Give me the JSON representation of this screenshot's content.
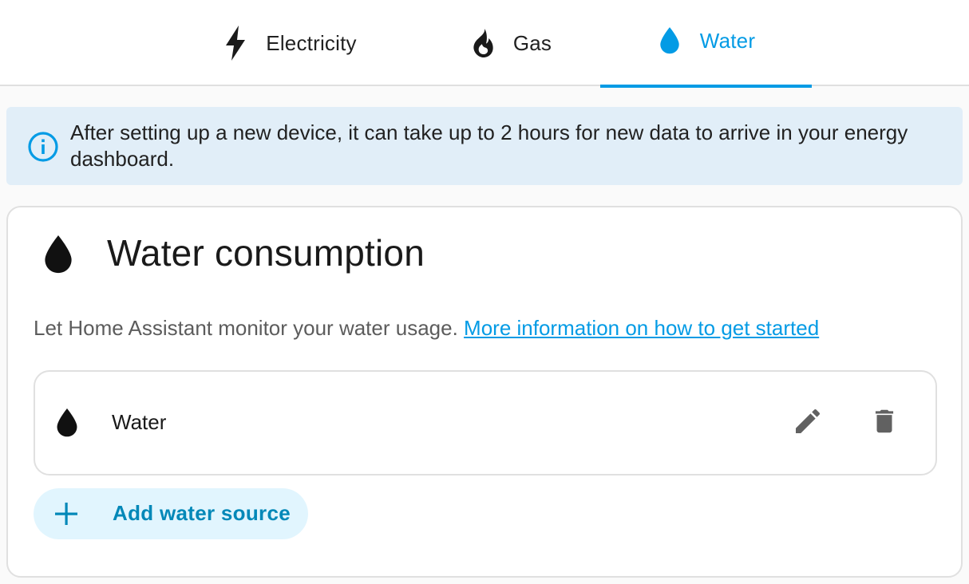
{
  "tabs": [
    {
      "label": "Electricity",
      "icon": "lightning-bolt-icon"
    },
    {
      "label": "Gas",
      "icon": "fire-icon"
    },
    {
      "label": "Water",
      "icon": "water-drop-icon",
      "active": true
    }
  ],
  "alert": {
    "icon": "info-icon",
    "text": "After setting up a new device, it can take up to 2 hours for new data to arrive in your energy dashboard."
  },
  "card": {
    "icon": "water-drop-icon",
    "title": "Water consumption",
    "description": "Let Home Assistant monitor your water usage.",
    "link_text": "More information on how to get started",
    "sources": [
      {
        "label": "Water",
        "icon": "water-drop-icon"
      }
    ],
    "add_button_label": "Add water source"
  },
  "colors": {
    "accent": "#039be5",
    "alert_bg": "#e1eef8",
    "add_button_bg": "#e1f5fe",
    "icon_grey": "#616161"
  }
}
